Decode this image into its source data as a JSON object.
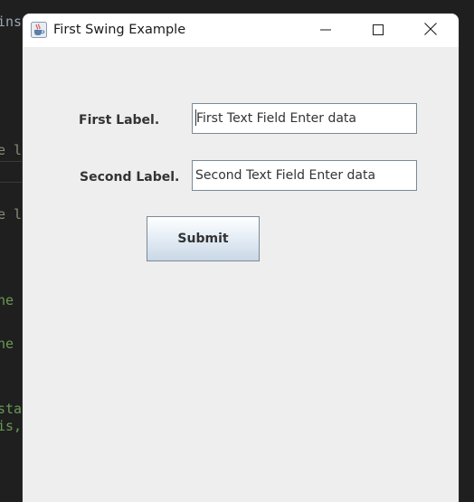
{
  "background": {
    "lines": [
      {
        "text": "ins",
        "color": "#9aa7b0"
      },
      {
        "text": "e l",
        "color": "#8a8a7a"
      },
      {
        "text": "e l",
        "color": "#8a8a7a"
      },
      {
        "text": "he",
        "color": "#6a9955"
      },
      {
        "text": "he",
        "color": "#6a9955"
      },
      {
        "text": "sta",
        "color": "#6a9955"
      },
      {
        "text": "is,",
        "color": "#6a9955"
      }
    ]
  },
  "window": {
    "title": "First Swing Example",
    "app_icon": "java-cup-icon",
    "controls": {
      "minimize_icon": "minimize-icon",
      "maximize_icon": "maximize-icon",
      "close_icon": "close-icon"
    }
  },
  "form": {
    "first_label": "First Label.",
    "first_field_value": "First Text Field Enter data",
    "second_label": "Second Label.",
    "second_field_value": "Second Text Field Enter data",
    "submit_label": "Submit"
  },
  "colors": {
    "window_bg": "#eeeeee",
    "titlebar_bg": "#ffffff",
    "field_border": "#7a8a99",
    "button_gradient_top": "#ffffff",
    "button_gradient_bottom": "#c9d8e6"
  }
}
